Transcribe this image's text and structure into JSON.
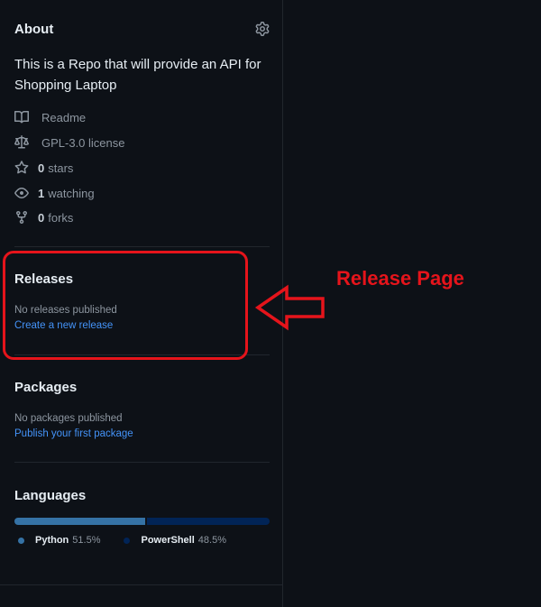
{
  "about": {
    "title": "About",
    "description": "This is a Repo that will provide an API for Shopping Laptop",
    "meta": [
      {
        "icon": "book-icon",
        "strong": "",
        "label": "Readme"
      },
      {
        "icon": "scale-icon",
        "strong": "",
        "label": "GPL-3.0 license"
      },
      {
        "icon": "star-icon",
        "strong": "0",
        "label": "stars"
      },
      {
        "icon": "eye-icon",
        "strong": "1",
        "label": "watching"
      },
      {
        "icon": "fork-icon",
        "strong": "0",
        "label": "forks"
      }
    ]
  },
  "releases": {
    "title": "Releases",
    "empty_text": "No releases published",
    "link": "Create a new release"
  },
  "packages": {
    "title": "Packages",
    "empty_text": "No packages published",
    "link": "Publish your first package"
  },
  "languages": {
    "title": "Languages",
    "items": [
      {
        "name": "Python",
        "percent": "51.5%",
        "value": 51.5,
        "color": "#3572a5"
      },
      {
        "name": "PowerShell",
        "percent": "48.5%",
        "value": 48.5,
        "color": "#012456"
      }
    ]
  },
  "annotation": {
    "text": "Release Page",
    "color": "#e5141b"
  },
  "colors": {
    "background": "#0d1117",
    "link": "#4493f8",
    "muted": "#8d96a0",
    "border": "#21262d"
  }
}
